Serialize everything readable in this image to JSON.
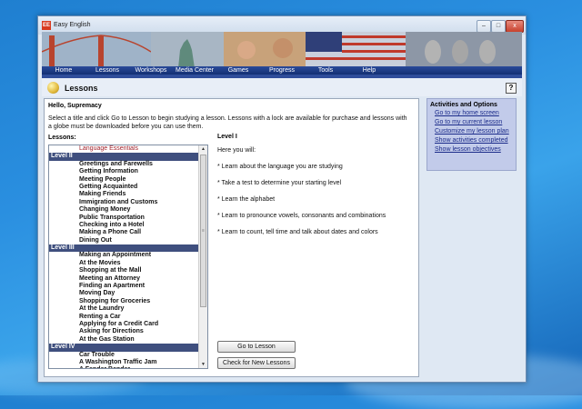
{
  "window": {
    "title": "Easy English",
    "app_icon": "EE",
    "controls": {
      "minimize": "–",
      "maximize": "□",
      "close": "x"
    }
  },
  "nav": {
    "items": [
      "Home",
      "Lessons",
      "Workshops",
      "Media Center",
      "Games",
      "Progress",
      "Tools",
      "Help"
    ]
  },
  "header": {
    "title": "Lessons",
    "help": "?"
  },
  "main": {
    "greeting": "Hello, Supremacy",
    "instructions": "Select a title and click Go to Lesson to begin studying a lesson. Lessons with a lock are available for purchase and lessons with a globe must be downloaded before you can use them.",
    "lessons_label": "Lessons:",
    "list": [
      {
        "type": "item",
        "label": "Language Essentials",
        "style": "red"
      },
      {
        "type": "level",
        "label": "Level II"
      },
      {
        "type": "item",
        "label": "Greetings and Farewells"
      },
      {
        "type": "item",
        "label": "Getting Information"
      },
      {
        "type": "item",
        "label": "Meeting People"
      },
      {
        "type": "item",
        "label": "Getting Acquainted"
      },
      {
        "type": "item",
        "label": "Making Friends"
      },
      {
        "type": "item",
        "label": "Immigration and Customs"
      },
      {
        "type": "item",
        "label": "Changing Money"
      },
      {
        "type": "item",
        "label": "Public Transportation"
      },
      {
        "type": "item",
        "label": "Checking into a Hotel"
      },
      {
        "type": "item",
        "label": "Making a Phone Call"
      },
      {
        "type": "item",
        "label": "Dining Out"
      },
      {
        "type": "level",
        "label": "Level III"
      },
      {
        "type": "item",
        "label": "Making an Appointment"
      },
      {
        "type": "item",
        "label": "At the Movies"
      },
      {
        "type": "item",
        "label": "Shopping at the Mall"
      },
      {
        "type": "item",
        "label": "Meeting an Attorney"
      },
      {
        "type": "item",
        "label": "Finding an Apartment"
      },
      {
        "type": "item",
        "label": "Moving Day"
      },
      {
        "type": "item",
        "label": "Shopping for Groceries"
      },
      {
        "type": "item",
        "label": "At the Laundry"
      },
      {
        "type": "item",
        "label": "Renting a Car"
      },
      {
        "type": "item",
        "label": "Applying for a Credit Card"
      },
      {
        "type": "item",
        "label": "Asking for Directions"
      },
      {
        "type": "item",
        "label": "At the Gas Station"
      },
      {
        "type": "level",
        "label": "Level IV"
      },
      {
        "type": "item",
        "label": "Car Trouble"
      },
      {
        "type": "item",
        "label": "A Washington Traffic Jam"
      },
      {
        "type": "item",
        "label": "A Fender Bender"
      }
    ],
    "scroll": {
      "up": "▲",
      "down": "▼",
      "grip": "≡"
    },
    "detail": {
      "title": "Level I",
      "lines": [
        "Here you will:",
        "* Learn about the language you are studying",
        "* Take a test to determine your starting level",
        "* Learn the alphabet",
        "* Learn to pronounce vowels, consonants and combinations",
        "* Learn to count, tell time and talk about dates and colors"
      ]
    },
    "buttons": {
      "go_to_lesson": "Go to Lesson",
      "check_new": "Check for New Lessons"
    }
  },
  "side": {
    "title": "Activities and Options",
    "links": [
      "Go to my home screen",
      "Go to my current lesson",
      "Customize my lesson plan",
      "Show activities completed",
      "Show lesson objectives"
    ]
  }
}
